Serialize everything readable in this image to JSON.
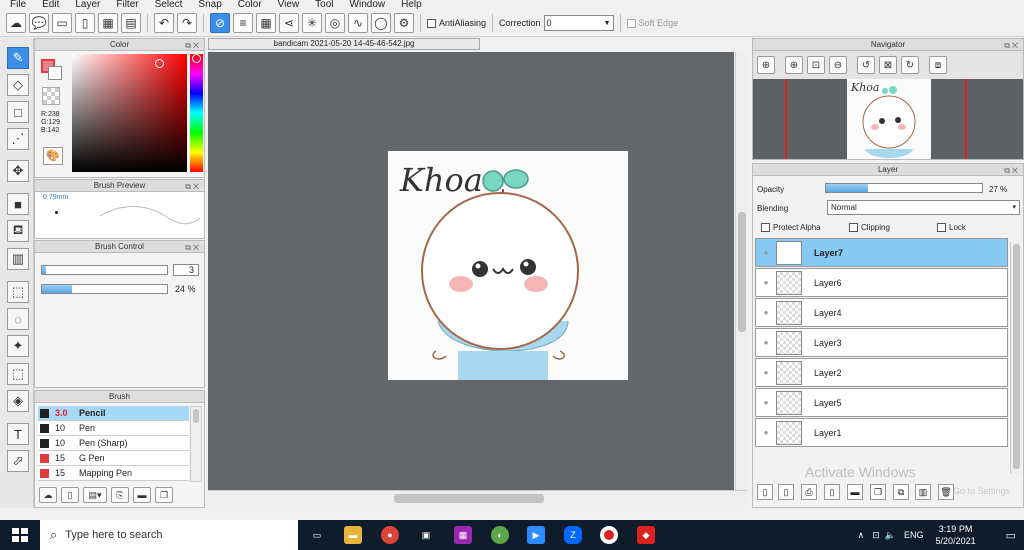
{
  "menu": [
    "File",
    "Edit",
    "Layer",
    "Filter",
    "Select",
    "Snap",
    "Color",
    "View",
    "Tool",
    "Window",
    "Help"
  ],
  "toolbar": {
    "antialiasing_label": "AntiAliasing",
    "correction_label": "Correction",
    "correction_value": "0",
    "soft_edge_label": "Soft Edge"
  },
  "color_panel": {
    "title": "Color",
    "r": "R:238",
    "g": "G:129",
    "b": "B:142",
    "fg_color": "#ee818e"
  },
  "brush_preview": {
    "title": "Brush Preview",
    "size": "0.79mm"
  },
  "brush_control": {
    "title": "Brush Control",
    "size_value": "3",
    "opacity_value": "24 %",
    "opacity_fraction": 0.24
  },
  "brush_list": {
    "title": "Brush",
    "items": [
      {
        "size": "3.0",
        "name": "Pencil",
        "color": "#222222"
      },
      {
        "size": "10",
        "name": "Pen",
        "color": "#222222"
      },
      {
        "size": "10",
        "name": "Pen (Sharp)",
        "color": "#222222"
      },
      {
        "size": "15",
        "name": "G Pen",
        "color": "#e03a3a"
      },
      {
        "size": "15",
        "name": "Mapping Pen",
        "color": "#e03a3a"
      }
    ]
  },
  "canvas": {
    "tab_title": "bandicam 2021-05-20 14-45-46-542.jpg",
    "art_text": "Khoa",
    "background": "#636669"
  },
  "navigator": {
    "title": "Navigator",
    "art_text": "Khoa"
  },
  "layer_panel": {
    "title": "Layer",
    "opacity_label": "Opacity",
    "opacity_value": "27 %",
    "opacity_fraction": 0.27,
    "blending_label": "Blending",
    "blending_value": "Normal",
    "protect_alpha_label": "Protect Alpha",
    "clipping_label": "Clipping",
    "lock_label": "Lock",
    "layers": [
      "Layer7",
      "Layer6",
      "Layer4",
      "Layer3",
      "Layer2",
      "Layer5",
      "Layer1"
    ],
    "watermark": "Activate Windows",
    "watermark_sub": "Go to Settings to activate Windows."
  },
  "taskbar": {
    "search_placeholder": "Type here to search",
    "language": "ENG",
    "time": "3:19 PM",
    "date": "5/20/2021"
  }
}
